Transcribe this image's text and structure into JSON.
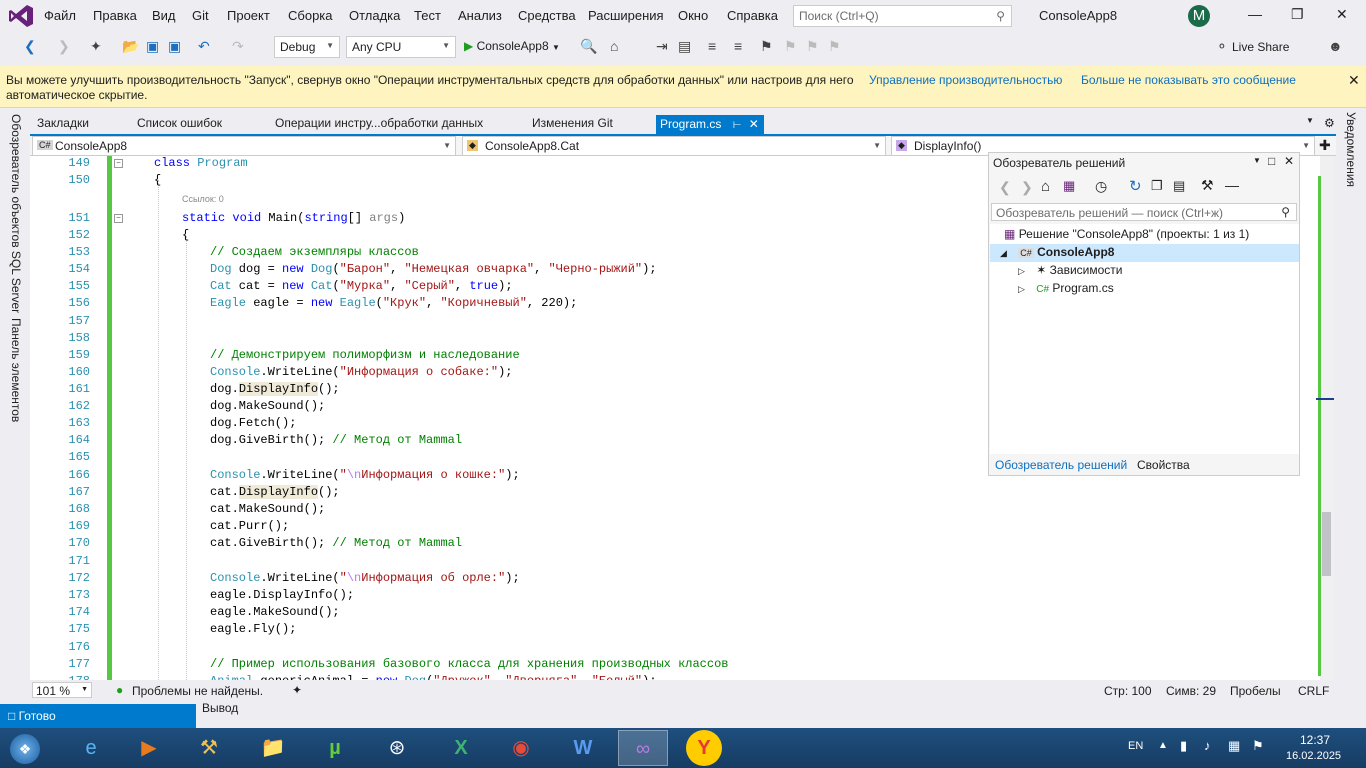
{
  "menu": {
    "items": [
      "Файл",
      "Правка",
      "Вид",
      "Git",
      "Проект",
      "Сборка",
      "Отладка",
      "Тест",
      "Анализ",
      "Средства",
      "Расширения",
      "Окно",
      "Справка"
    ],
    "search_placeholder": "Поиск (Ctrl+Q)",
    "solution_name": "ConsoleApp8",
    "avatar_letter": "M"
  },
  "toolbar": {
    "config": "Debug",
    "platform": "Any CPU",
    "start_label": "ConsoleApp8",
    "live_share": "Live Share"
  },
  "infobar": {
    "text": "Вы можете улучшить производительность \"Запуск\", свернув окно \"Операции инструментальных средств для обработки данных\" или настроив для него автоматическое скрытие.",
    "link1": "Управление производительностью",
    "link2": "Больше не показывать это сообщение"
  },
  "left_panels": [
    "Обозреватель объектов SQL Server",
    "Панель элементов"
  ],
  "right_panels": [
    "Уведомления"
  ],
  "doc_tabs": [
    "Закладки",
    "Список ошибок",
    "Операции инстру...обработки данных",
    "Изменения Git"
  ],
  "active_tab": "Program.cs",
  "navbar": {
    "project": "ConsoleApp8",
    "class": "ConsoleApp8.Cat",
    "member": "DisplayInfo()"
  },
  "code_lines": [
    {
      "n": "149",
      "html": "<span class='kw'>class</span> <span class='ty'>Program</span>",
      "indent": 1,
      "fold": true
    },
    {
      "n": "150",
      "html": "{",
      "indent": 1
    },
    {
      "n": "151",
      "html": "<span class='kw'>static</span> <span class='kw'>void</span> Main(<span class='kw'>string</span>[] <span class='pr'>args</span>)",
      "indent": 2,
      "fold": true,
      "refs": "Ссылок: 0"
    },
    {
      "n": "152",
      "html": "{",
      "indent": 2
    },
    {
      "n": "153",
      "html": "<span class='cm'>// Создаем экземпляры классов</span>",
      "indent": 3
    },
    {
      "n": "154",
      "html": "<span class='ty'>Dog</span> dog = <span class='kw'>new</span> <span class='ty'>Dog</span>(<span class='st'>\"Барон\"</span>, <span class='st'>\"Немецкая овчарка\"</span>, <span class='st'>\"Черно-рыжий\"</span>);",
      "indent": 3
    },
    {
      "n": "155",
      "html": "<span class='ty'>Cat</span> cat = <span class='kw'>new</span> <span class='ty'>Cat</span>(<span class='st'>\"Мурка\"</span>, <span class='st'>\"Серый\"</span>, <span class='kw'>true</span>);",
      "indent": 3
    },
    {
      "n": "156",
      "html": "<span class='ty'>Eagle</span> eagle = <span class='kw'>new</span> <span class='ty'>Eagle</span>(<span class='st'>\"Крук\"</span>, <span class='st'>\"Коричневый\"</span>, 220);",
      "indent": 3
    },
    {
      "n": "157",
      "html": "",
      "indent": 3
    },
    {
      "n": "158",
      "html": "",
      "indent": 3
    },
    {
      "n": "159",
      "html": "<span class='cm'>// Демонстрируем полиморфизм и наследование</span>",
      "indent": 3
    },
    {
      "n": "160",
      "html": "<span class='ty'>Console</span>.WriteLine(<span class='st'>\"Информация о собаке:\"</span>);",
      "indent": 3
    },
    {
      "n": "161",
      "html": "dog.<span class='hl'>DisplayInfo</span>();",
      "indent": 3
    },
    {
      "n": "162",
      "html": "dog.MakeSound();",
      "indent": 3
    },
    {
      "n": "163",
      "html": "dog.Fetch();",
      "indent": 3
    },
    {
      "n": "164",
      "html": "dog.GiveBirth(); <span class='cm'>// Метод от Mammal</span>",
      "indent": 3
    },
    {
      "n": "165",
      "html": "",
      "indent": 3
    },
    {
      "n": "166",
      "html": "<span class='ty'>Console</span>.WriteLine(<span class='st'>\"</span><span class='es'>\\n</span><span class='st'>Информация о кошке:\"</span>);",
      "indent": 3
    },
    {
      "n": "167",
      "html": "cat.<span class='hl'>DisplayInfo</span>();",
      "indent": 3
    },
    {
      "n": "168",
      "html": "cat.MakeSound();",
      "indent": 3
    },
    {
      "n": "169",
      "html": "cat.Purr();",
      "indent": 3
    },
    {
      "n": "170",
      "html": "cat.GiveBirth(); <span class='cm'>// Метод от Mammal</span>",
      "indent": 3
    },
    {
      "n": "171",
      "html": "",
      "indent": 3
    },
    {
      "n": "172",
      "html": "<span class='ty'>Console</span>.WriteLine(<span class='st'>\"</span><span class='es'>\\n</span><span class='st'>Информация об орле:\"</span>);",
      "indent": 3
    },
    {
      "n": "173",
      "html": "eagle.DisplayInfo();",
      "indent": 3
    },
    {
      "n": "174",
      "html": "eagle.MakeSound();",
      "indent": 3
    },
    {
      "n": "175",
      "html": "eagle.Fly();",
      "indent": 3
    },
    {
      "n": "176",
      "html": "",
      "indent": 3
    },
    {
      "n": "177",
      "html": "<span class='cm'>// Пример использования базового класса для хранения производных классов</span>",
      "indent": 3
    },
    {
      "n": "178",
      "html": "<span class='ty'>Animal</span> genericAnimal = <span class='kw'>new</span> <span class='ty'>Dog</span>(<span class='st'>\"Дружок\"</span>, <span class='st'>\"Дворняга\"</span>, <span class='st'>\"Белый\"</span>);",
      "indent": 3
    }
  ],
  "solution_explorer": {
    "title": "Обозреватель решений",
    "search_placeholder": "Обозреватель решений — поиск (Ctrl+ж)",
    "solution": "Решение \"ConsoleApp8\" (проекты: 1 из 1)",
    "project": "ConsoleApp8",
    "dependencies": "Зависимости",
    "file": "Program.cs",
    "tab1": "Обозреватель решений",
    "tab2": "Свойства"
  },
  "editor_status": {
    "zoom": "101 %",
    "problems": "Проблемы не найдены.",
    "line": "Стр: 100",
    "col": "Симв: 29",
    "spaces": "Пробелы",
    "eol": "CRLF"
  },
  "output": {
    "title": "Вывод"
  },
  "status": {
    "ready": "Готово"
  },
  "tray": {
    "lang": "EN",
    "time": "12:37",
    "date": "16.02.2025"
  },
  "colors": {
    "accent": "#007acc",
    "vs_purple": "#68217a",
    "change_green": "#57c844"
  }
}
